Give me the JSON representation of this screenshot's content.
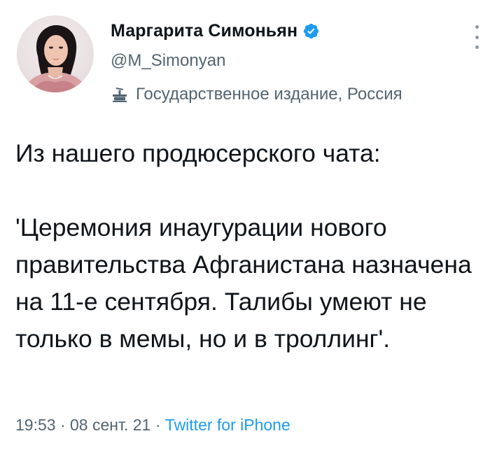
{
  "author": {
    "display_name": "Маргарита Симоньян",
    "handle": "@M_Simonyan",
    "verified_icon": "verified-badge-icon",
    "label_icon": "government-building-icon",
    "label": "Государственное издание, Россия"
  },
  "tweet": {
    "text": "Из нашего продюсерского чата:\n\n'Церемония инаугурации нового правительства Афганистана назначена на 11-е сентября. Талибы умеют не только в мемы, но и в троллинг'."
  },
  "meta": {
    "time": "19:53",
    "separator": " · ",
    "date": "08 сент. 21",
    "source": "Twitter for iPhone"
  },
  "colors": {
    "accent": "#1d9bf0",
    "text_primary": "#0f1419",
    "text_secondary": "#536471"
  }
}
